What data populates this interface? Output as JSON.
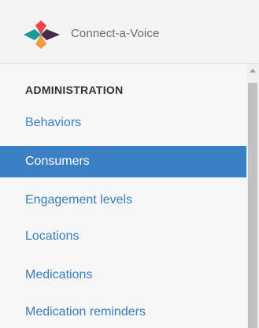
{
  "brand": {
    "name": "Connect-a-Voice",
    "logo_colors": {
      "left": "#1a9a9a",
      "top": "#e9474b",
      "right": "#4a2a4a",
      "bottom": "#f19a3e"
    }
  },
  "nav": {
    "heading": "ADMINISTRATION",
    "items": [
      {
        "label": "Behaviors",
        "active": false
      },
      {
        "label": "Consumers",
        "active": true
      },
      {
        "label": "Engagement levels",
        "active": false
      },
      {
        "label": "Locations",
        "active": false
      },
      {
        "label": "Medications",
        "active": false
      },
      {
        "label": "Medication reminders",
        "active": false
      }
    ]
  },
  "colors": {
    "link": "#3a7dc0",
    "active_bg": "#3b7fc4",
    "active_text": "#ffffff",
    "heading": "#333333"
  }
}
